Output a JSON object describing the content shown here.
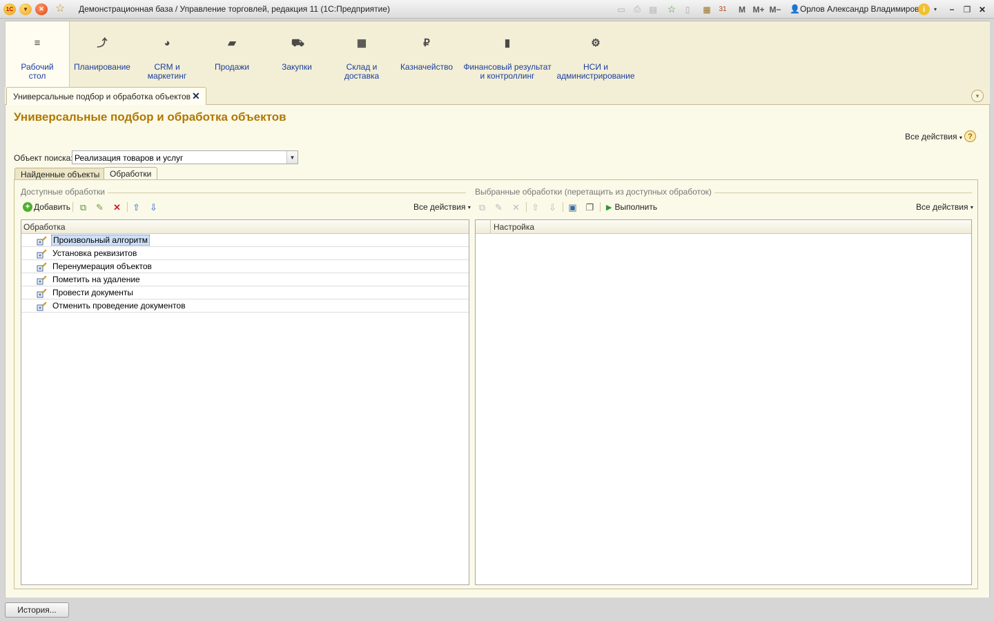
{
  "window": {
    "title": "Демонстрационная база / Управление торговлей, редакция 11  (1С:Предприятие)",
    "logo_text": "1С",
    "user": "Орлов Александр Владимиров...",
    "m_buttons": [
      "M",
      "M+",
      "M−"
    ]
  },
  "sections": [
    {
      "label": "Рабочий\nстол",
      "icon": "menu-icon"
    },
    {
      "label": "Планирование",
      "icon": "planning-icon"
    },
    {
      "label": "CRM и\nмаркетинг",
      "icon": "pie-chart-icon"
    },
    {
      "label": "Продажи",
      "icon": "shopping-bag-icon"
    },
    {
      "label": "Закупки",
      "icon": "cart-icon"
    },
    {
      "label": "Склад и\nдоставка",
      "icon": "warehouse-grid-icon"
    },
    {
      "label": "Казначейство",
      "icon": "ruble-icon"
    },
    {
      "label": "Финансовый результат\nи контроллинг",
      "icon": "bar-chart-icon"
    },
    {
      "label": "НСИ и\nадминистрирование",
      "icon": "gear-icon"
    }
  ],
  "open_tab": {
    "label": "Универсальные подбор и обработка объектов"
  },
  "form": {
    "title": "Универсальные подбор и обработка объектов",
    "all_actions": "Все действия",
    "help": "?",
    "search_label": "Объект поиска:",
    "search_value": "Реализация товаров и услуг",
    "tabs": [
      "Найденные объекты",
      "Обработки"
    ],
    "active_tab": "Обработки"
  },
  "available": {
    "title": "Доступные обработки",
    "add_label": "Добавить",
    "all_actions": "Все действия",
    "column": "Обработка",
    "rows": [
      "Произвольный алгоритм",
      "Установка реквизитов",
      "Перенумерация объектов",
      "Пометить на удаление",
      "Провести документы",
      "Отменить проведение документов"
    ],
    "selected_row": 0
  },
  "selected": {
    "title": "Выбранные обработки (перетащить из доступных обработок)",
    "execute_label": "Выполнить",
    "all_actions": "Все действия",
    "column": "Настройка"
  },
  "status": {
    "history_label": "История..."
  },
  "colors": {
    "accent_title": "#b07800",
    "section_label": "#1a3d9c",
    "panel_bg": "#fbf9e8"
  }
}
